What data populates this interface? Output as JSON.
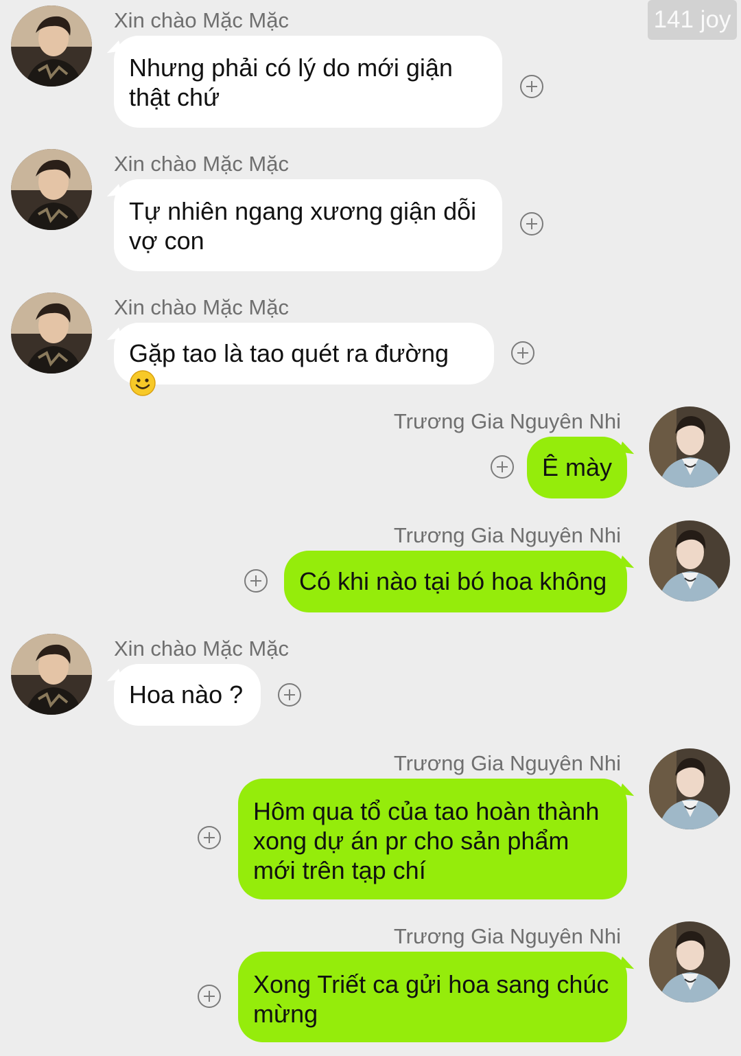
{
  "watermark": "141 joy",
  "participants": {
    "other": {
      "name": "Xin chào Mặc Mặc",
      "bubble_color": "#ffffff"
    },
    "me": {
      "name": "Trương Gia Nguyên Nhi",
      "bubble_color": "#95ec0b"
    }
  },
  "background_color": "#ededed",
  "messages": [
    {
      "side": "left",
      "sender": "Xin chào Mặc Mặc",
      "text": "Nhưng phải có lý do mới giận\nthật chứ"
    },
    {
      "side": "left",
      "sender": "Xin chào Mặc Mặc",
      "text": "Tự nhiên ngang xương giận dỗi\nvợ con"
    },
    {
      "side": "left",
      "sender": "Xin chào Mặc Mặc",
      "text": "Gặp tao là tao quét ra đường ",
      "emoji": "smiley-face-icon"
    },
    {
      "side": "right",
      "sender": "Trương Gia Nguyên Nhi",
      "text": "Ê mày"
    },
    {
      "side": "right",
      "sender": "Trương Gia Nguyên Nhi",
      "text": "Có khi nào tại bó hoa không"
    },
    {
      "side": "left",
      "sender": "Xin chào Mặc Mặc",
      "text": "Hoa nào ?"
    },
    {
      "side": "right",
      "sender": "Trương Gia Nguyên Nhi",
      "text": "Hôm qua tổ của tao hoàn thành\nxong dự án pr cho sản phẩm\nmới trên tạp chí"
    },
    {
      "side": "right",
      "sender": "Trương Gia Nguyên Nhi",
      "text": "Xong Triết ca gửi hoa sang chúc\nmừng"
    }
  ]
}
